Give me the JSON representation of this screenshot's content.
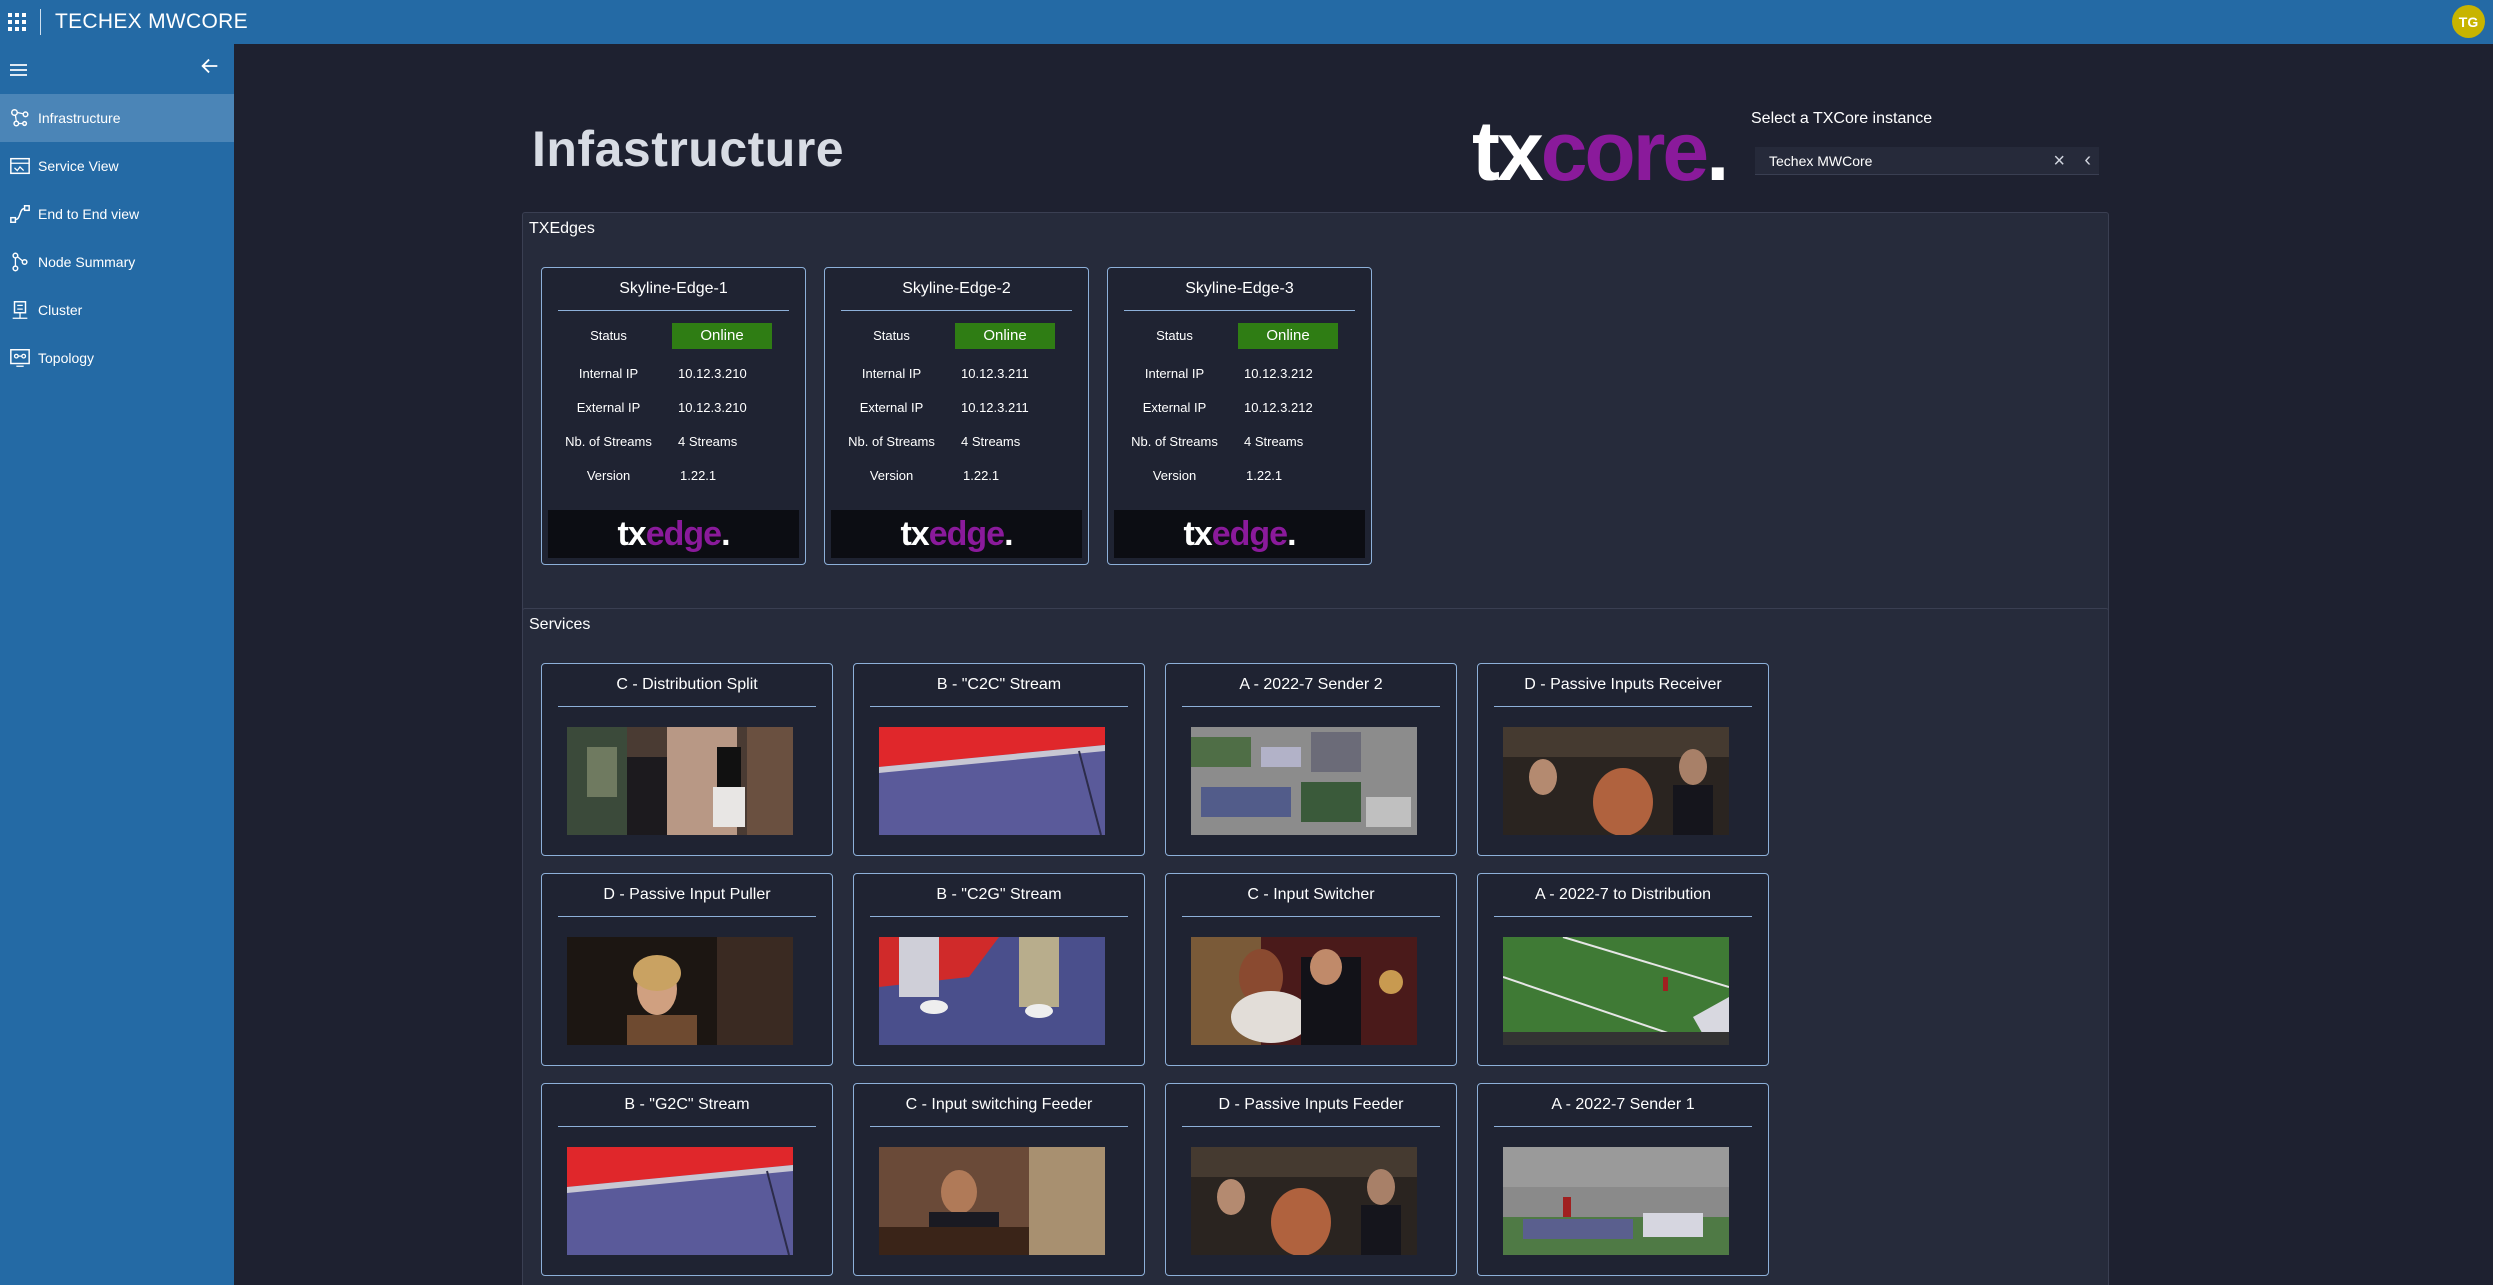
{
  "app": {
    "title": "TECHEX MWCORE",
    "user_initials": "TG"
  },
  "sidebar": {
    "items": [
      {
        "label": "Infrastructure",
        "icon": "infrastructure-icon",
        "active": true
      },
      {
        "label": "Service View",
        "icon": "service-view-icon",
        "active": false
      },
      {
        "label": "End to End view",
        "icon": "end-to-end-icon",
        "active": false
      },
      {
        "label": "Node Summary",
        "icon": "node-summary-icon",
        "active": false
      },
      {
        "label": "Cluster",
        "icon": "cluster-icon",
        "active": false
      },
      {
        "label": "Topology",
        "icon": "topology-icon",
        "active": false
      }
    ]
  },
  "page": {
    "title": "Infastructure",
    "logo": {
      "tx": "tx",
      "core": "core",
      "dot": "."
    },
    "instance_label": "Select a TXCore instance",
    "instance_value": "Techex MWCore"
  },
  "edges": {
    "title": "TXEdges",
    "labels": {
      "status": "Status",
      "internal_ip": "Internal IP",
      "external_ip": "External IP",
      "streams": "Nb. of Streams",
      "version": "Version"
    },
    "logo": {
      "tx": "tx",
      "edge": "edge",
      "dot": "."
    },
    "items": [
      {
        "name": "Skyline-Edge-1",
        "status": "Online",
        "internal_ip": "10.12.3.210",
        "external_ip": "10.12.3.210",
        "streams": "4 Streams",
        "version": "1.22.1"
      },
      {
        "name": "Skyline-Edge-2",
        "status": "Online",
        "internal_ip": "10.12.3.211",
        "external_ip": "10.12.3.211",
        "streams": "4 Streams",
        "version": "1.22.1"
      },
      {
        "name": "Skyline-Edge-3",
        "status": "Online",
        "internal_ip": "10.12.3.212",
        "external_ip": "10.12.3.212",
        "streams": "4 Streams",
        "version": "1.22.1"
      }
    ]
  },
  "services": {
    "title": "Services",
    "items": [
      {
        "name": "C - Distribution Split"
      },
      {
        "name": "B - \"C2C\" Stream"
      },
      {
        "name": "A - 2022-7 Sender 2"
      },
      {
        "name": "D - Passive Inputs Receiver"
      },
      {
        "name": "D - Passive Input Puller"
      },
      {
        "name": "B - \"C2G\" Stream"
      },
      {
        "name": "C - Input Switcher"
      },
      {
        "name": "A - 2022-7 to Distribution"
      },
      {
        "name": "B - \"G2C\" Stream"
      },
      {
        "name": "C - Input switching Feeder"
      },
      {
        "name": "D - Passive Inputs Feeder"
      },
      {
        "name": "A - 2022-7 Sender 1"
      }
    ]
  }
}
